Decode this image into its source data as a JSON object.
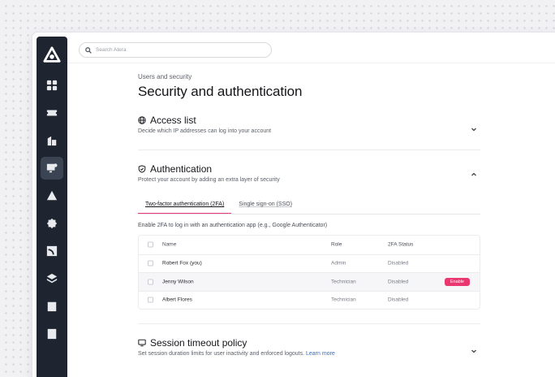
{
  "search": {
    "placeholder": "Search Atera"
  },
  "sidebar": {
    "items": [
      {
        "icon": "dashboard-icon"
      },
      {
        "icon": "tickets-icon"
      },
      {
        "icon": "customers-icon"
      },
      {
        "icon": "devices-icon",
        "active": true
      },
      {
        "icon": "alerts-icon"
      },
      {
        "icon": "patch-icon"
      },
      {
        "icon": "network-icon"
      },
      {
        "icon": "software-icon"
      },
      {
        "icon": "reports-icon"
      },
      {
        "icon": "knowledge-base-icon"
      }
    ]
  },
  "page": {
    "eyebrow": "Users and security",
    "title": "Security and authentication"
  },
  "access_list": {
    "title": "Access list",
    "description": "Decide which IP addresses can log into your account"
  },
  "authentication": {
    "title": "Authentication",
    "description": "Protect your account by adding an extra layer of security",
    "tabs": [
      {
        "label": "Two-factor authentication (2FA)",
        "active": true
      },
      {
        "label": "Single sign-on (SSO)",
        "active": false
      }
    ],
    "hint": "Enable 2FA to log in with an authentication app (e.g., Google Authenticator)",
    "table": {
      "columns": {
        "name": "Name",
        "role": "Role",
        "status": "2FA Status"
      },
      "rows": [
        {
          "name": "Robert Fox (you)",
          "role": "Admin",
          "status": "Disabled"
        },
        {
          "name": "Jenny Wilson",
          "role": "Technician",
          "status": "Disabled",
          "action": "Enable"
        },
        {
          "name": "Albert Flores",
          "role": "Technician",
          "status": "Disabled"
        }
      ]
    }
  },
  "session_timeout": {
    "title": "Session timeout policy",
    "description": "Set session duration limits for user inactivity and enforced logouts.",
    "link": "Learn more"
  },
  "colors": {
    "accent": "#e8386f",
    "sidebar": "#1e2530",
    "link": "#2d6fd6"
  }
}
